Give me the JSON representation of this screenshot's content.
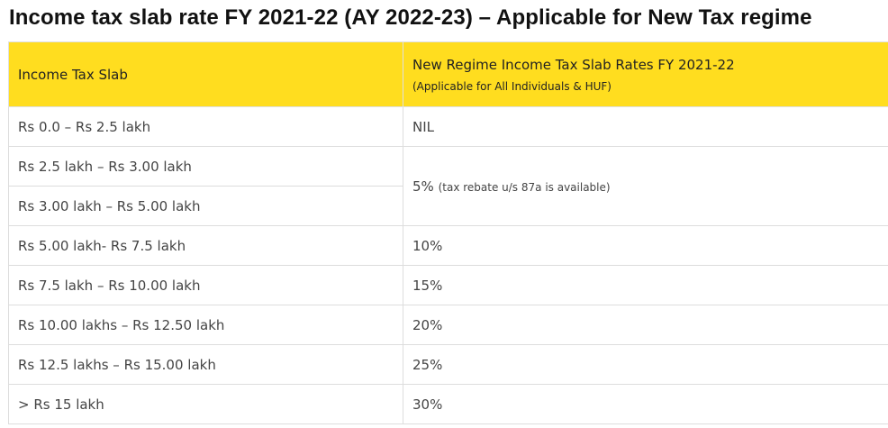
{
  "title": "Income tax slab rate FY 2021-22 (AY 2022-23) – Applicable for New Tax regime",
  "table": {
    "headers": {
      "col1": "Income Tax Slab",
      "col2": "New Regime Income Tax Slab Rates FY 2021-22",
      "col2_sub": "(Applicable for All Individuals & HUF)"
    },
    "rows": [
      {
        "slab": "Rs 0.0 – Rs 2.5 lakh",
        "rate": "NIL"
      },
      {
        "slab": "Rs 2.5 lakh – Rs 3.00 lakh",
        "rate": "5%",
        "rate_note": "(tax rebate u/s 87a is available)"
      },
      {
        "slab": "Rs 3.00 lakh – Rs 5.00 lakh"
      },
      {
        "slab": "Rs 5.00 lakh- Rs 7.5 lakh",
        "rate": "10%"
      },
      {
        "slab": "Rs 7.5 lakh – Rs 10.00 lakh",
        "rate": "15%"
      },
      {
        "slab": "Rs 10.00 lakhs – Rs 12.50 lakh",
        "rate": "20%"
      },
      {
        "slab": "Rs 12.5 lakhs – Rs 15.00 lakh",
        "rate": "25%"
      },
      {
        "slab": "> Rs 15 lakh",
        "rate": "30%"
      }
    ]
  },
  "colors": {
    "header_bg": "#ffdd1f",
    "border": "#dddddd"
  }
}
